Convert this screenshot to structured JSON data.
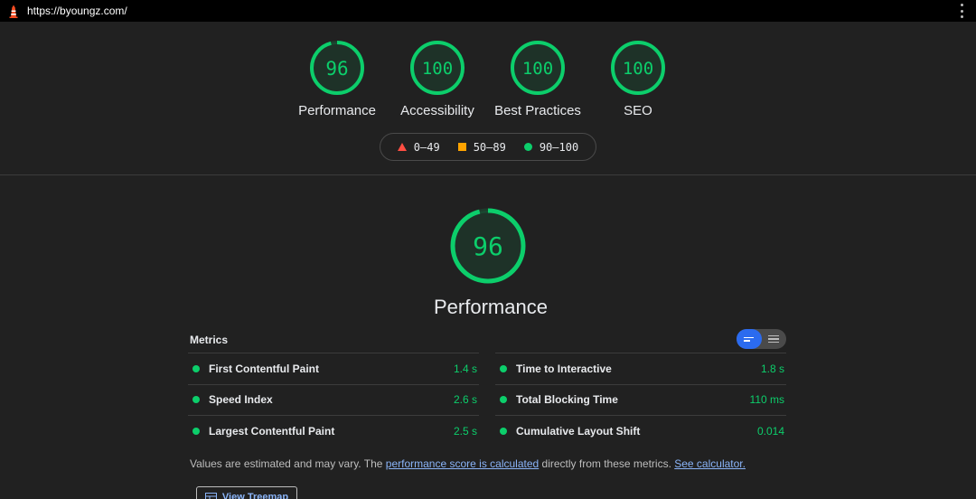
{
  "topbar": {
    "url": "https://byoungz.com/",
    "logo_icon": "lighthouse-icon",
    "menu_icon": "kebab-menu-icon"
  },
  "colors": {
    "pass": "#0cce6b",
    "average": "#ffa400",
    "fail": "#ff4e42",
    "accent": "#2b6bef",
    "link": "#8ab4f8"
  },
  "scores": [
    {
      "label": "Performance",
      "value": "96",
      "fraction": 0.96
    },
    {
      "label": "Accessibility",
      "value": "100",
      "fraction": 1.0
    },
    {
      "label": "Best Practices",
      "value": "100",
      "fraction": 1.0
    },
    {
      "label": "SEO",
      "value": "100",
      "fraction": 1.0
    }
  ],
  "legend": [
    {
      "range": "0–49",
      "shape": "triangle"
    },
    {
      "range": "50–89",
      "shape": "square"
    },
    {
      "range": "90–100",
      "shape": "circle"
    }
  ],
  "performance": {
    "score": "96",
    "fraction": 0.96,
    "title": "Performance"
  },
  "metrics": {
    "header": "Metrics",
    "left": [
      {
        "name": "First Contentful Paint",
        "value": "1.4 s"
      },
      {
        "name": "Speed Index",
        "value": "2.6 s"
      },
      {
        "name": "Largest Contentful Paint",
        "value": "2.5 s"
      }
    ],
    "right": [
      {
        "name": "Time to Interactive",
        "value": "1.8 s"
      },
      {
        "name": "Total Blocking Time",
        "value": "110 ms"
      },
      {
        "name": "Cumulative Layout Shift",
        "value": "0.014"
      }
    ]
  },
  "note": {
    "before": "Values are estimated and may vary. The ",
    "link1": "performance score is calculated",
    "middle": " directly from these metrics. ",
    "link2": "See calculator."
  },
  "treemap": {
    "label": "View Treemap"
  }
}
